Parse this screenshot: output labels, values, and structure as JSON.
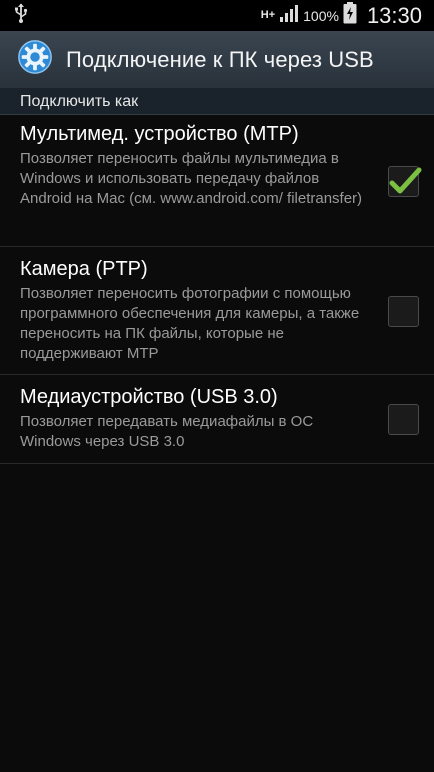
{
  "status_bar": {
    "usb_icon": "usb-icon",
    "network_type": "H+",
    "battery_percent": "100%",
    "time": "13:30"
  },
  "action_bar": {
    "icon": "settings-gear-icon",
    "title": "Подключение к ПК через USB"
  },
  "section": {
    "header": "Подключить как"
  },
  "options": [
    {
      "title": "Мультимед. устройство (MTP)",
      "description": "Позволяет переносить файлы мультимедиа в Windows и использовать передачу файлов Android на Mac (см. www.android.com/ filetransfer)",
      "checked": true
    },
    {
      "title": "Камера (PTP)",
      "description": "Позволяет переносить фотографии с помощью программного обеспечения для камеры, а также переносить на ПК файлы, которые не поддерживают MTP",
      "checked": false
    },
    {
      "title": "Медиаустройство (USB 3.0)",
      "description": "Позволяет передавать медиафайлы в ОС Windows через USB 3.0",
      "checked": false
    }
  ],
  "colors": {
    "check_green": "#7cc043",
    "action_bar": "#323c46",
    "section_header": "#1a232b"
  }
}
